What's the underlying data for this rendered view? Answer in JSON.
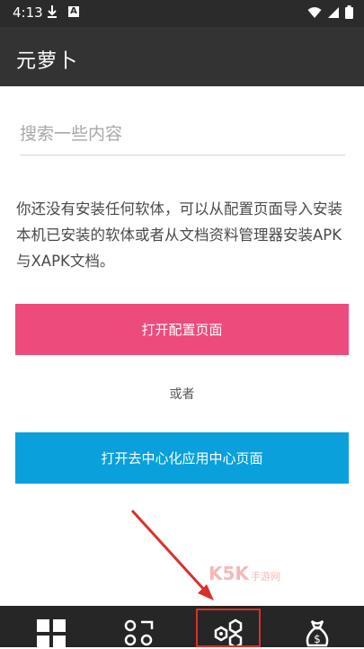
{
  "status_bar": {
    "time": "4:13",
    "icons": [
      "download-icon",
      "a-notification-icon",
      "wifi-icon",
      "signal-icon",
      "battery-icon"
    ]
  },
  "app_bar": {
    "title": "元萝卜"
  },
  "search": {
    "placeholder": "搜索一些内容",
    "value": ""
  },
  "empty_state": {
    "message": "你还没有安装任何软体，可以从配置页面导入安装本机已安装的软体或者从文档资料管理器安装APK与XAPK文档。",
    "open_config_button": "打开配置页面",
    "or_text": "或者",
    "open_decentral_button": "打开去中心化应用中心页面"
  },
  "watermark": {
    "text": "K5K",
    "sub": "手游网"
  },
  "bottom_nav": {
    "items": [
      {
        "icon": "apps-grid-icon"
      },
      {
        "icon": "scan-icon"
      },
      {
        "icon": "hexagon-nodes-icon",
        "selected": true
      },
      {
        "icon": "money-bag-icon"
      }
    ]
  },
  "colors": {
    "app_bar": "#333333",
    "primary_button": "#ee4b7d",
    "secondary_button": "#0aa0db",
    "annotation_red": "#d9302c"
  }
}
